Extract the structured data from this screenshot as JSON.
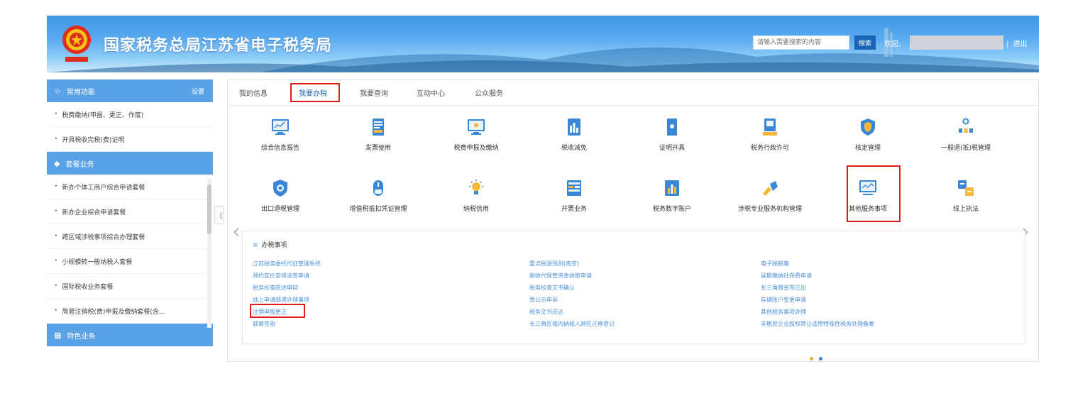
{
  "header": {
    "site_title": "国家税务总局江苏省电子税务局",
    "search_placeholder": "请输入需要搜索的内容",
    "search_button": "搜索",
    "welcome": "欢迎,",
    "separator": "|",
    "logout": "退出"
  },
  "sidebar": {
    "sections": [
      {
        "title": "常用功能",
        "action": "设置"
      },
      {
        "title": "套餐业务"
      },
      {
        "title": "特色业务"
      }
    ],
    "common_items": [
      "税费缴纳(申报、更正、作废)",
      "开具税收完税(费)证明"
    ],
    "package_items": [
      "新办个体工商户综合申请套餐",
      "新办企业综合申请套餐",
      "跨区域涉税事项综合办理套餐",
      "小规模转一般纳税人套餐",
      "国际税收业务套餐",
      "简易注销税(费)申报及缴纳套餐(含..."
    ],
    "collapse_label": "《"
  },
  "tabs": [
    "我的信息",
    "我要办税",
    "我要查询",
    "互动中心",
    "公众服务"
  ],
  "active_tab": "我要办税",
  "services_row1": [
    {
      "label": "综合信息报告",
      "icon": "monitor-chart-icon"
    },
    {
      "label": "发票使用",
      "icon": "document-icon"
    },
    {
      "label": "税费申报及缴纳",
      "icon": "monitor-icon"
    },
    {
      "label": "税收减免",
      "icon": "building-icon"
    },
    {
      "label": "证明开具",
      "icon": "certificate-icon"
    },
    {
      "label": "税务行政许可",
      "icon": "license-icon"
    },
    {
      "label": "核定管理",
      "icon": "shield-icon"
    },
    {
      "label": "一般退(抵)税管理",
      "icon": "people-icon"
    }
  ],
  "services_row2": [
    {
      "label": "出口退税管理",
      "icon": "badge-icon"
    },
    {
      "label": "增值税抵扣凭证管理",
      "icon": "mouse-icon"
    },
    {
      "label": "纳税信用",
      "icon": "bulb-icon"
    },
    {
      "label": "开票业务",
      "icon": "invoice-icon"
    },
    {
      "label": "税务数字账户",
      "icon": "chart-icon"
    },
    {
      "label": "涉税专业服务机构管理",
      "icon": "tools-icon"
    },
    {
      "label": "其他服务事项",
      "icon": "screen-icon"
    },
    {
      "label": "线上执法",
      "icon": "law-icon"
    }
  ],
  "sub_panel": {
    "title": "办税事项",
    "col1": [
      "江苏税务委托代征管理系统",
      "预约定价安排谈签申请",
      "税务检查陈述申辩",
      "线上申请邮递办理事项",
      "注销申报更正",
      "邮寄签收"
    ],
    "col2": [
      "重点税源预测(南京)",
      "税收代保管资金收取申请",
      "税务检查文书确认",
      "受公示申诉",
      "税务文书送达",
      "长三角区域内纳税人跨区迁移登记"
    ],
    "col3": [
      "电子税邮箱",
      "延期缴纳社保费申请",
      "长三角跨省市迁出",
      "存储账户变更申请",
      "其他税务事项办理",
      "非居民企业股权转让适用特殊性税务处理备案"
    ]
  },
  "colors": {
    "accent": "#1a65b8",
    "highlight": "#e21a1a",
    "link": "#4c8fd6",
    "sidebar_header": "#5aa2e8"
  }
}
